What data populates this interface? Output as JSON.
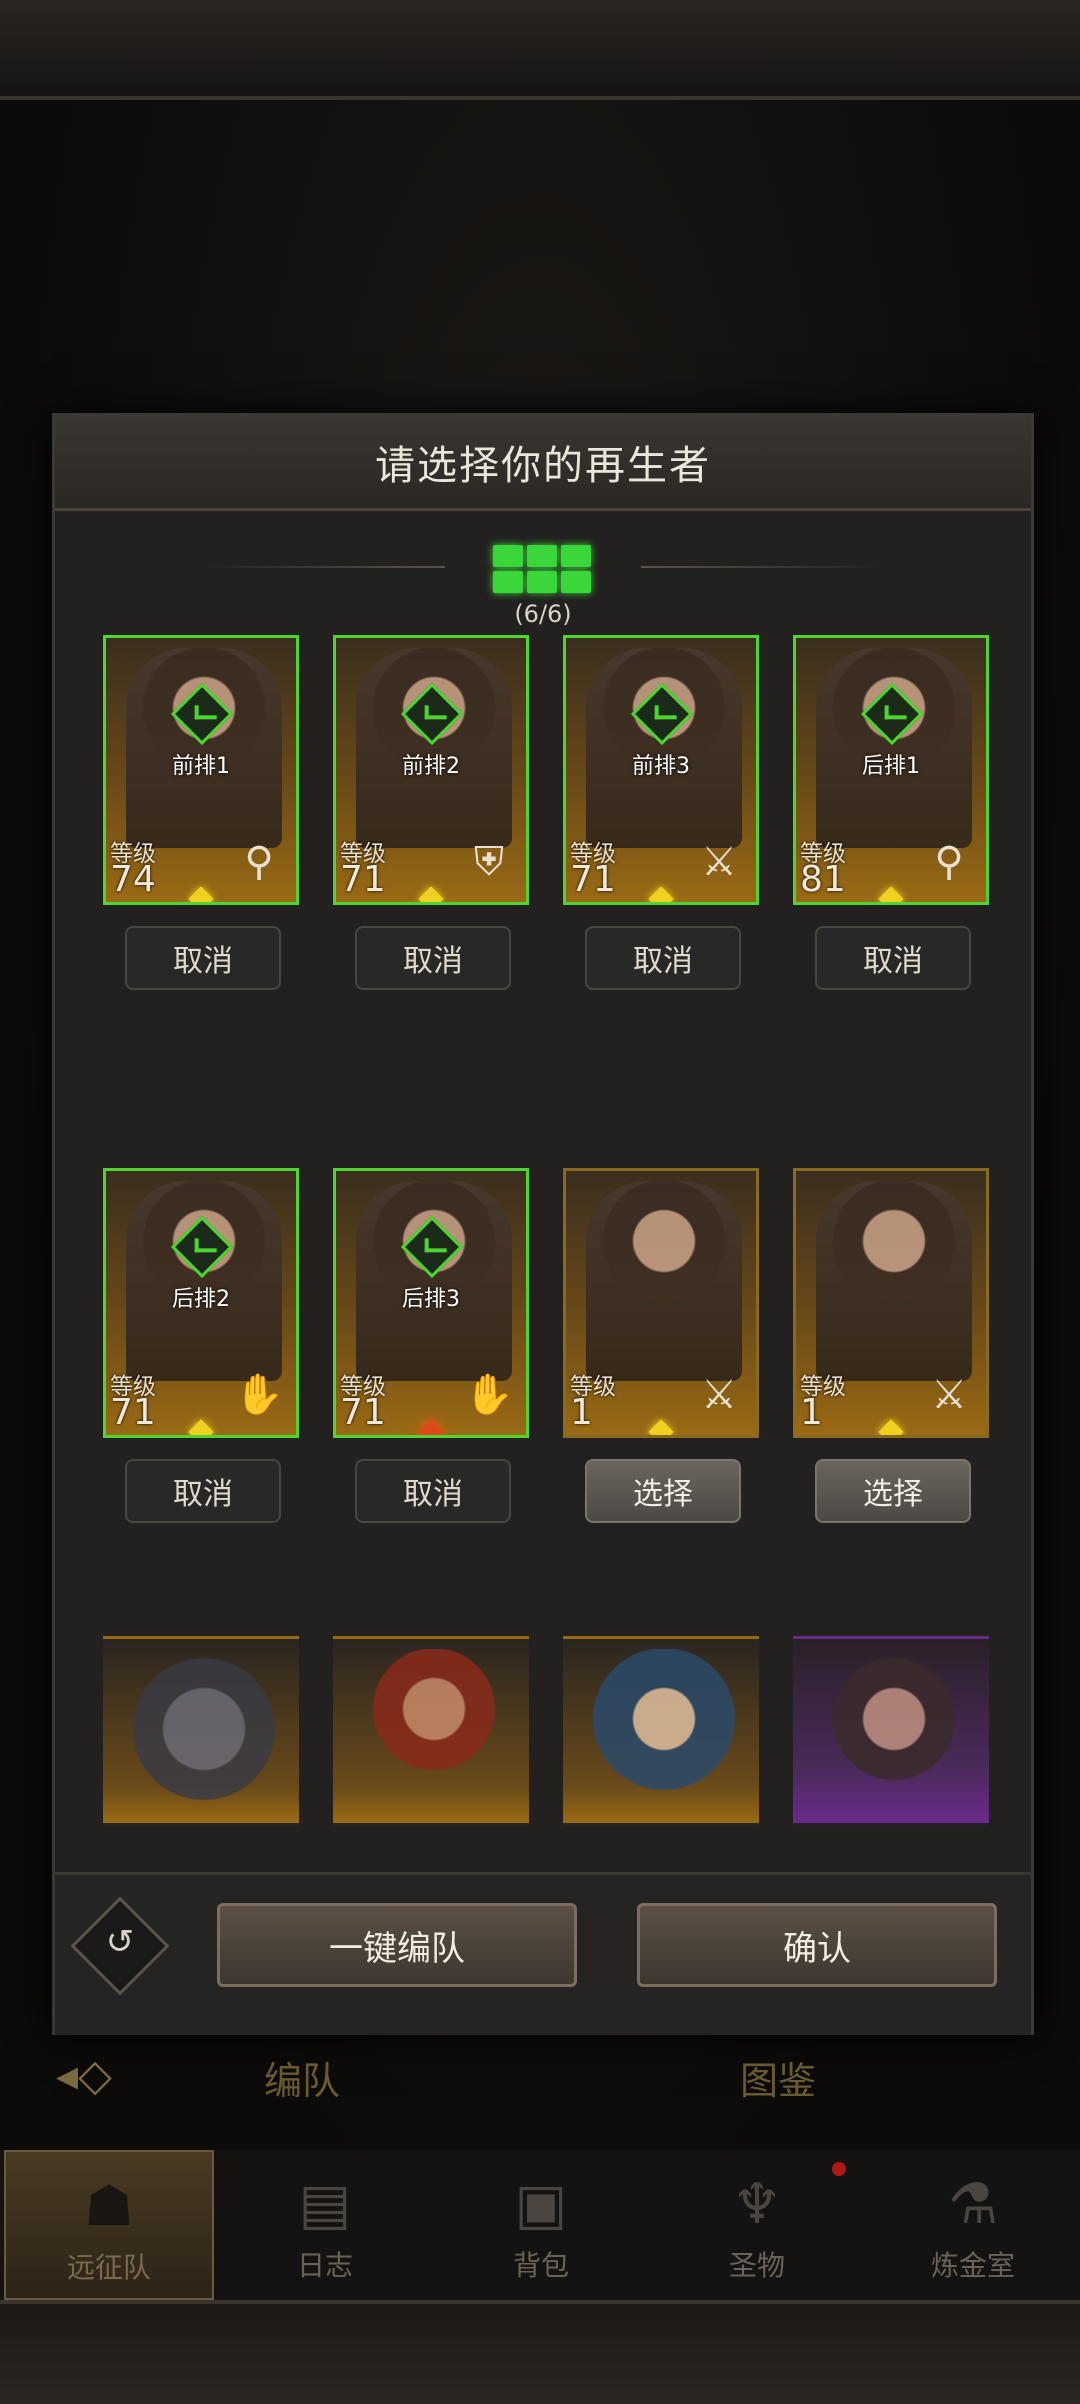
{
  "modal": {
    "title": "请选择你的再生者",
    "team_count": "(6/6)"
  },
  "heroes": [
    {
      "position": "前排1",
      "level_label": "等级",
      "level": "74",
      "role_icon": "staff-icon",
      "button": "取消",
      "selected": true
    },
    {
      "position": "前排2",
      "level_label": "等级",
      "level": "71",
      "role_icon": "shield-icon",
      "button": "取消",
      "selected": true
    },
    {
      "position": "前排3",
      "level_label": "等级",
      "level": "71",
      "role_icon": "sword-icon",
      "button": "取消",
      "selected": true
    },
    {
      "position": "后排1",
      "level_label": "等级",
      "level": "81",
      "role_icon": "staff-icon",
      "button": "取消",
      "selected": true
    },
    {
      "position": "后排2",
      "level_label": "等级",
      "level": "71",
      "role_icon": "hand-icon",
      "button": "取消",
      "selected": true
    },
    {
      "position": "后排3",
      "level_label": "等级",
      "level": "71",
      "role_icon": "hand-icon",
      "button": "取消",
      "selected": true
    },
    {
      "position": "",
      "level_label": "等级",
      "level": "1",
      "role_icon": "sword-icon",
      "button": "选择",
      "selected": false
    },
    {
      "position": "",
      "level_label": "等级",
      "level": "1",
      "role_icon": "sword-icon",
      "button": "选择",
      "selected": false
    }
  ],
  "footer": {
    "auto_team": "一键编队",
    "confirm": "确认"
  },
  "tabs": {
    "formation": "编队",
    "codex": "图鉴"
  },
  "nav": {
    "expedition": "远征队",
    "journal": "日志",
    "backpack": "背包",
    "relic": "圣物",
    "alchemy": "炼金室"
  },
  "colors": {
    "selected_border": "#4cd62f",
    "accent_gold": "#f0d020"
  }
}
